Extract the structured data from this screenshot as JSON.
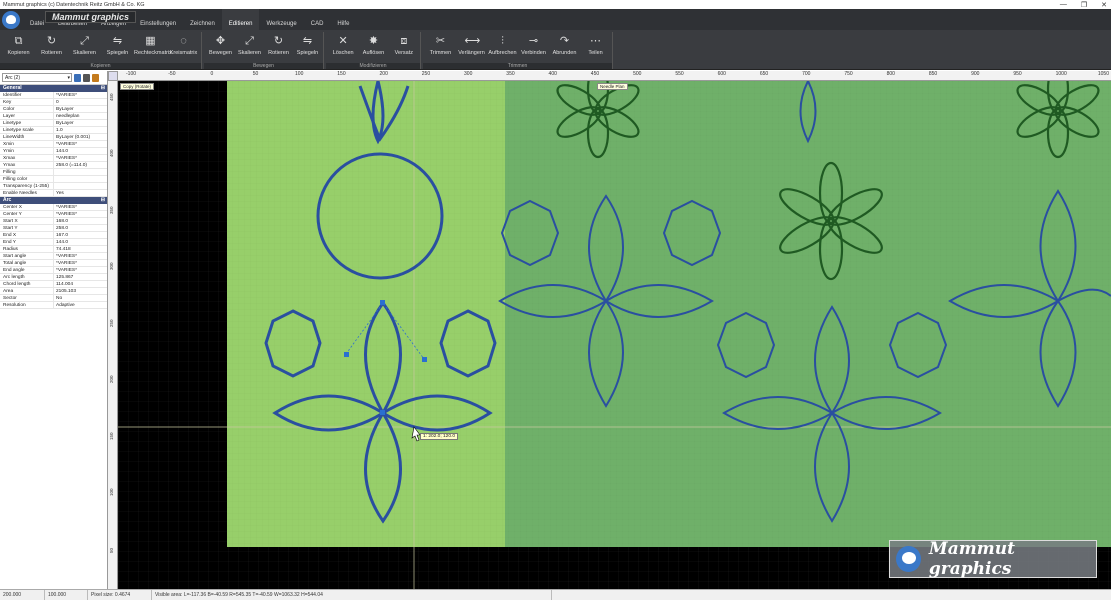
{
  "window": {
    "title": "Mammut graphics (c) Datentechnik Reitz GmbH & Co. KG",
    "controls": [
      "—",
      "❐",
      "✕"
    ]
  },
  "menu": {
    "brand": "Mammut graphics",
    "items": [
      "Datei",
      "Bearbeiten",
      "Anzeigen",
      "Einstellungen",
      "Zeichnen",
      "Editieren",
      "Werkzeuge",
      "CAD",
      "Hilfe"
    ],
    "active_index": 5
  },
  "ribbon": {
    "groups": [
      {
        "label": "Kopieren",
        "buttons": [
          {
            "label": "Kopieren",
            "icon": "copy-icon"
          },
          {
            "label": "Rotieren",
            "icon": "rotate-icon"
          },
          {
            "label": "Skalieren",
            "icon": "scale-icon"
          },
          {
            "label": "Spiegeln",
            "icon": "mirror-icon"
          },
          {
            "label": "Rechteckmatrix",
            "icon": "rect-matrix-icon"
          },
          {
            "label": "Kreismatrix",
            "icon": "circle-matrix-icon"
          }
        ]
      },
      {
        "label": "Bewegen",
        "buttons": [
          {
            "label": "Bewegen",
            "icon": "move-icon"
          },
          {
            "label": "Skalieren",
            "icon": "scale-icon"
          },
          {
            "label": "Rotieren",
            "icon": "rotate-icon"
          },
          {
            "label": "Spiegeln",
            "icon": "mirror-icon"
          }
        ]
      },
      {
        "label": "Modifizieren",
        "buttons": [
          {
            "label": "Löschen",
            "icon": "delete-icon"
          },
          {
            "label": "Auflösen",
            "icon": "explode-icon"
          },
          {
            "label": "Versatz",
            "icon": "offset-icon"
          }
        ]
      },
      {
        "label": "Trimmen",
        "buttons": [
          {
            "label": "Trimmen",
            "icon": "trim-icon"
          },
          {
            "label": "Verlängern",
            "icon": "extend-icon"
          },
          {
            "label": "Aufbrechen",
            "icon": "break-icon"
          },
          {
            "label": "Verbinden",
            "icon": "join-icon"
          },
          {
            "label": "Abrunden",
            "icon": "fillet-icon"
          },
          {
            "label": "Teilen",
            "icon": "divide-icon"
          }
        ]
      }
    ]
  },
  "ruler": {
    "top_labels": [
      "-100",
      "-50",
      "0",
      "50",
      "100",
      "150",
      "200",
      "250",
      "300",
      "350",
      "400",
      "450",
      "500",
      "550",
      "600",
      "650",
      "700",
      "750",
      "800",
      "850",
      "900",
      "950",
      "1000",
      "1050"
    ],
    "left_labels": [
      "450",
      "400",
      "350",
      "300",
      "250",
      "200",
      "150",
      "100",
      "50"
    ]
  },
  "properties": {
    "selector": "Arc (2)",
    "general_title": "General",
    "general": [
      [
        "Identifier",
        "*VARIES*"
      ],
      [
        "Key",
        "0"
      ],
      [
        "Color",
        "ByLayer"
      ],
      [
        "Layer",
        "needleplan"
      ],
      [
        "Linetype",
        "ByLayer"
      ],
      [
        "Linetype scale",
        "1.0"
      ],
      [
        "LineWidth",
        "ByLayer (0.001)"
      ],
      [
        "Xmin",
        "*VARIES*"
      ],
      [
        "Ymin",
        "144.0"
      ],
      [
        "Xmax",
        "*VARIES*"
      ],
      [
        "Ymax",
        "258.0 (=114.0)"
      ],
      [
        "Filling",
        ""
      ],
      [
        "Filling color",
        ""
      ],
      [
        "Transparency (1-255)",
        ""
      ],
      [
        "Enable Needles",
        "Yes"
      ]
    ],
    "arc_title": "Arc",
    "arc": [
      [
        "Center X",
        "*VARIES*"
      ],
      [
        "Center Y",
        "*VARIES*"
      ],
      [
        "Start X",
        "168.0"
      ],
      [
        "Start Y",
        "258.0"
      ],
      [
        "End X",
        "167.0"
      ],
      [
        "End Y",
        "144.0"
      ],
      [
        "Radius",
        "74.418"
      ],
      [
        "Start angle",
        "*VARIES*"
      ],
      [
        "Total angle",
        "*VARIES*"
      ],
      [
        "End angle",
        "*VARIES*"
      ],
      [
        "Arc length",
        "125.867"
      ],
      [
        "Chord length",
        "114.004"
      ],
      [
        "Area",
        "2105.103"
      ],
      [
        "Sector",
        "No"
      ],
      [
        "Resolution",
        "Adaptive"
      ]
    ]
  },
  "canvas": {
    "frame1_label": "Copy (Rotate)",
    "frame2_label": "Needle Plan",
    "tooltip": "1: 202.0; 120.0",
    "colors": {
      "light_green": "#97cf6a",
      "mid_green": "#6fb069",
      "stitch_blue": "#2a4fa0",
      "flower_green": "#1f5a22"
    }
  },
  "watermark": {
    "text": "Mammut graphics"
  },
  "status": {
    "cells": [
      "200.000",
      "100.000",
      "Pixel size: 0.4674",
      "Visible area:  L=-117.36  B=-40.59  R=545.35  T=-40.59  W=1063.32  H=544.04"
    ]
  }
}
